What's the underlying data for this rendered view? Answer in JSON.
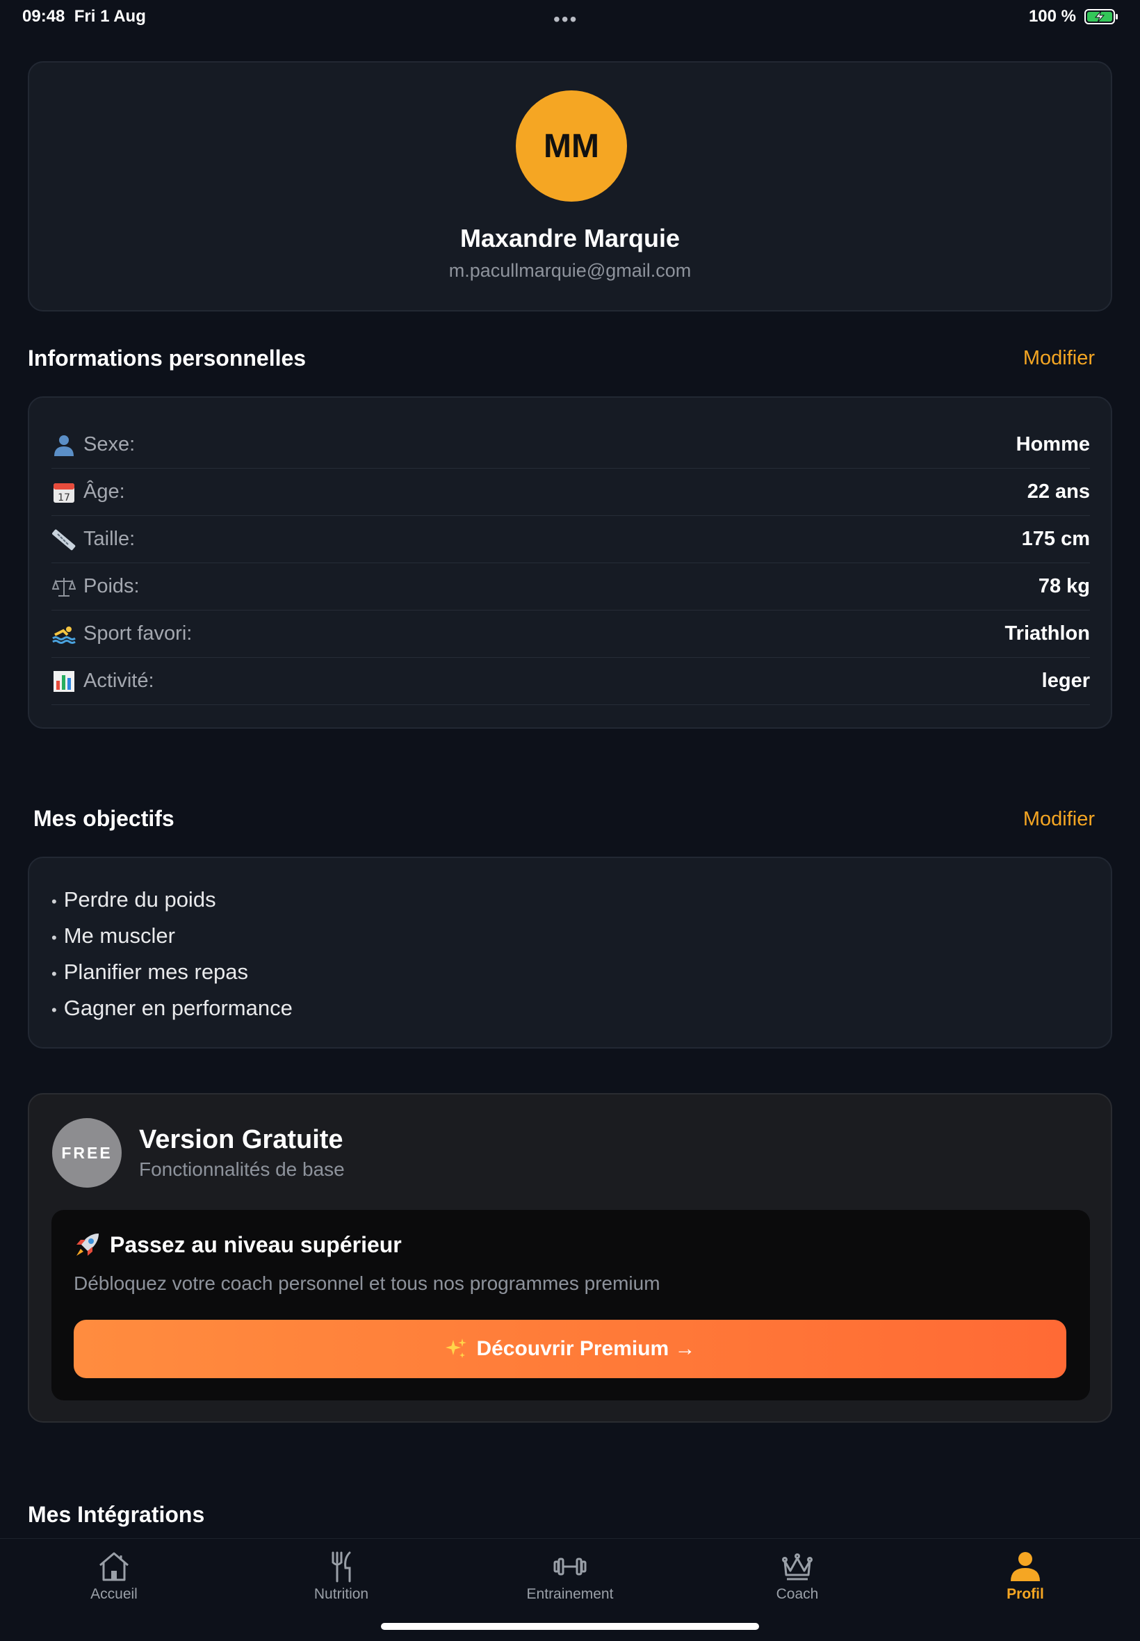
{
  "status_bar": {
    "time": "09:48",
    "date": "Fri 1 Aug",
    "dots": "•••",
    "battery": "100 %"
  },
  "profile": {
    "initials": "MM",
    "name": "Maxandre Marquie",
    "email": "m.pacullmarquie@gmail.com",
    "avatar_color": "#f5a623"
  },
  "personal_info": {
    "title": "Informations personnelles",
    "edit_label": "Modifier",
    "rows": [
      {
        "icon": "person-icon",
        "label": "Sexe:",
        "value": "Homme"
      },
      {
        "icon": "calendar-icon",
        "label": "Âge:",
        "value": "22 ans"
      },
      {
        "icon": "ruler-icon",
        "label": "Taille:",
        "value": "175 cm"
      },
      {
        "icon": "scale-icon",
        "label": "Poids:",
        "value": "78 kg"
      },
      {
        "icon": "swimmer-icon",
        "label": "Sport favori:",
        "value": "Triathlon"
      },
      {
        "icon": "bar-chart-icon",
        "label": "Activité:",
        "value": "leger"
      }
    ]
  },
  "goals": {
    "title": "Mes objectifs",
    "edit_label": "Modifier",
    "items": [
      "Perdre du poids",
      "Me muscler",
      "Planifier mes repas",
      "Gagner en performance"
    ]
  },
  "subscription": {
    "badge": "FREE",
    "title": "Version Gratuite",
    "subtitle": "Fonctionnalités de base",
    "upsell_title": "Passez au niveau supérieur",
    "upsell_desc": "Débloquez votre coach personnel et tous nos programmes premium",
    "button_label": "Découvrir Premium →"
  },
  "integrations": {
    "title": "Mes Intégrations"
  },
  "tabs": [
    {
      "icon": "home-icon",
      "label": "Accueil",
      "active": false
    },
    {
      "icon": "fork-knife-icon",
      "label": "Nutrition",
      "active": false
    },
    {
      "icon": "dumbbell-icon",
      "label": "Entrainement",
      "active": false
    },
    {
      "icon": "crown-icon",
      "label": "Coach",
      "active": false
    },
    {
      "icon": "person-icon",
      "label": "Profil",
      "active": true
    }
  ],
  "colors": {
    "accent": "#f5a623",
    "background": "#0d111a",
    "card": "#161b24",
    "premium_gradient_start": "#ff8c3f",
    "premium_gradient_end": "#ff6a35"
  }
}
